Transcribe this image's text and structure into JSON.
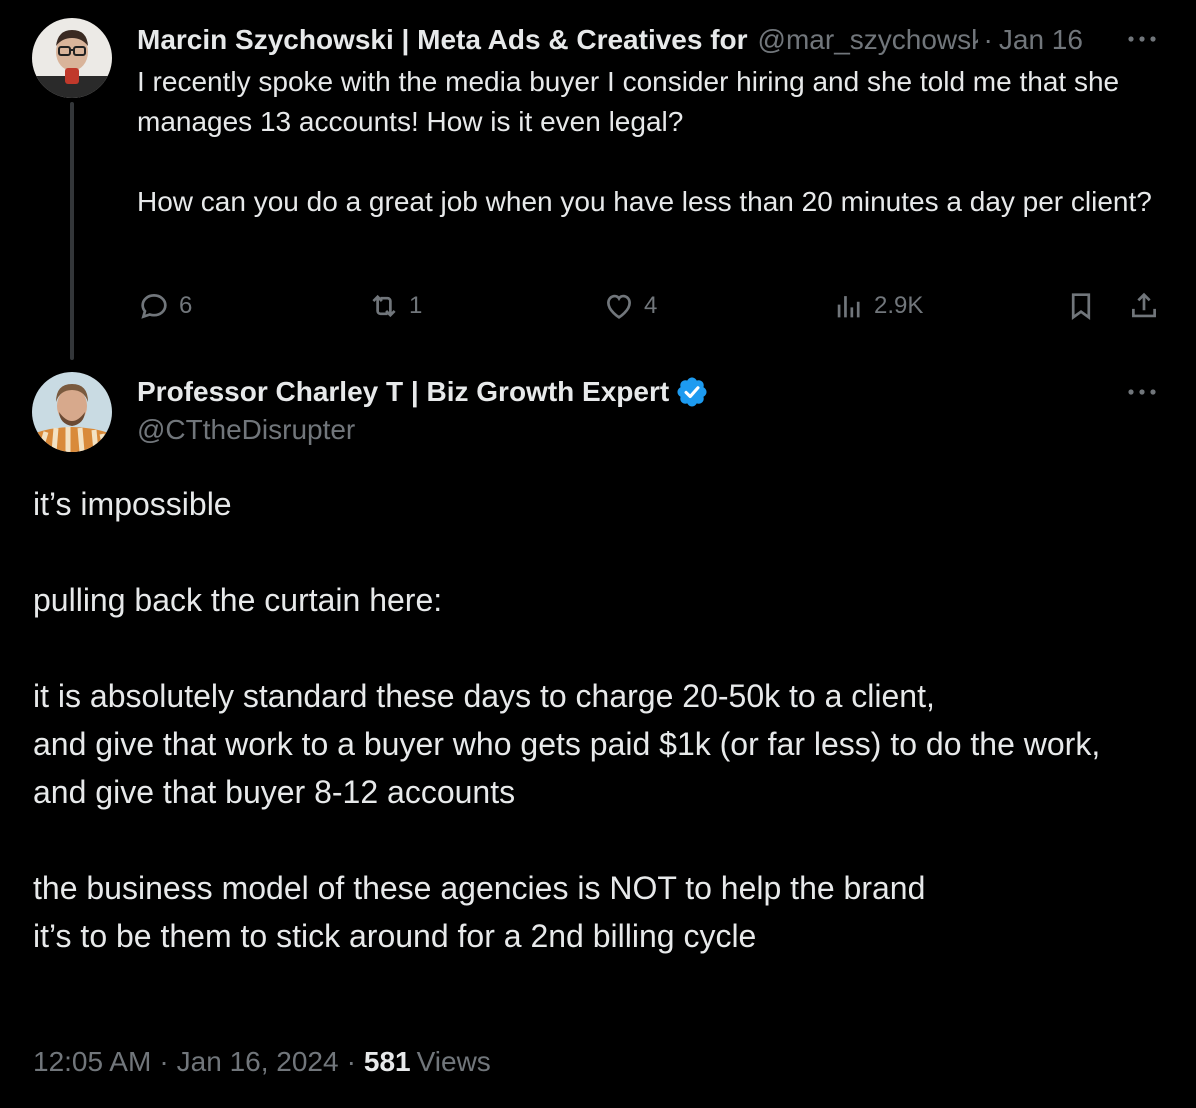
{
  "parent_tweet": {
    "author_name": "Marcin Szychowski | Meta Ads & Creatives for",
    "author_handle": "@mar_szychowski",
    "separator": "·",
    "date": "Jan 16",
    "text": "I recently spoke with the media buyer I consider hiring and she told me that she manages 13 accounts! How is it even legal?\n\nHow can you do a great job when you have less than 20 minutes a day per client?",
    "more_icon": "ellipsis-icon",
    "actions": {
      "replies": "6",
      "reposts": "1",
      "likes": "4",
      "views": "2.9K"
    },
    "action_icons": [
      "reply-icon",
      "repost-icon",
      "like-icon",
      "views-icon",
      "bookmark-icon",
      "share-icon"
    ]
  },
  "main_tweet": {
    "author_name": "Professor Charley T | Biz Growth Expert",
    "author_handle": "@CTtheDisrupter",
    "verified": true,
    "text": "it’s impossible\n\npulling back the curtain here:\n\nit is absolutely standard these days to charge 20-50k to a client,\nand give that work to a buyer who gets paid $1k (or far less) to do the work,\nand give that buyer 8-12 accounts\n\nthe business model of these agencies is NOT to help the brand\nit’s to be them to stick around for a 2nd billing cycle",
    "time": "12:05 AM",
    "separator": "·",
    "date": "Jan 16, 2024",
    "views_count": "581",
    "views_label": "Views"
  },
  "colors": {
    "background": "#000000",
    "text_primary": "#e7e9ea",
    "text_secondary": "#71767b",
    "verified_blue": "#1d9bf0",
    "thread_line": "#333639"
  }
}
